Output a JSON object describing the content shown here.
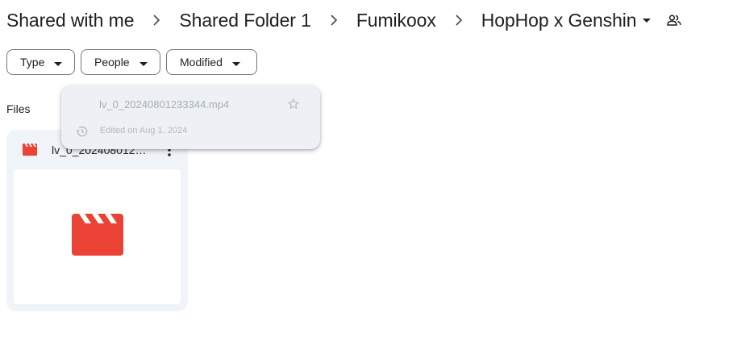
{
  "breadcrumb": {
    "items": [
      {
        "label": "Shared with me"
      },
      {
        "label": "Shared Folder 1"
      },
      {
        "label": "Fumikoox"
      }
    ],
    "current": {
      "label": "HopHop x Genshin"
    }
  },
  "filters": {
    "type_label": "Type",
    "people_label": "People",
    "modified_label": "Modified"
  },
  "files_section": {
    "label": "Files"
  },
  "file_card": {
    "name": "lv_0_20240801233344.mp4",
    "icon": "video-clapper-icon",
    "icon_color": "#ea4335"
  },
  "hover_tooltip": {
    "name": "lv_0_20240801233344.mp4",
    "meta": "Edited on Aug 1, 2024"
  }
}
